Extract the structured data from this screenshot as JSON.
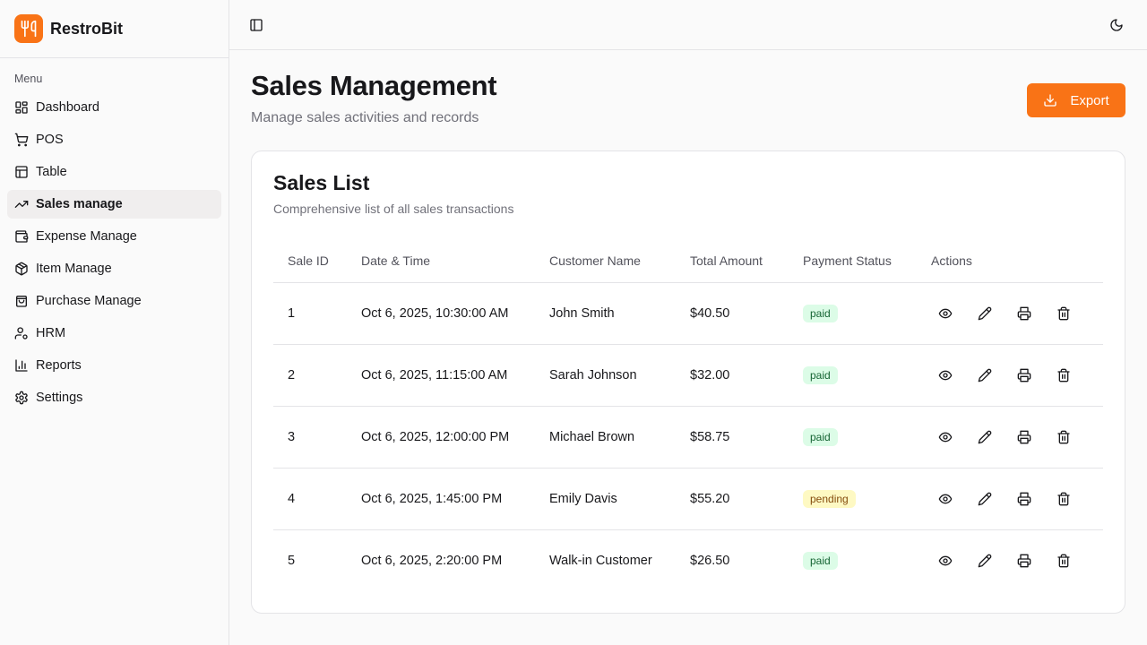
{
  "app": {
    "name": "RestroBit"
  },
  "sidebar": {
    "menu_label": "Menu",
    "items": [
      {
        "label": "Dashboard",
        "icon": "dashboard-icon"
      },
      {
        "label": "POS",
        "icon": "cart-icon"
      },
      {
        "label": "Table",
        "icon": "table-icon"
      },
      {
        "label": "Sales manage",
        "icon": "trending-up-icon",
        "active": true
      },
      {
        "label": "Expense Manage",
        "icon": "wallet-icon"
      },
      {
        "label": "Item Manage",
        "icon": "package-icon"
      },
      {
        "label": "Purchase Manage",
        "icon": "shopping-bag-icon"
      },
      {
        "label": "HRM",
        "icon": "user-cog-icon"
      },
      {
        "label": "Reports",
        "icon": "bar-chart-icon"
      },
      {
        "label": "Settings",
        "icon": "gear-icon"
      }
    ]
  },
  "header": {
    "title": "Sales Management",
    "subtitle": "Manage sales activities and records",
    "export_label": "Export"
  },
  "card": {
    "title": "Sales List",
    "description": "Comprehensive list of all sales transactions"
  },
  "table": {
    "columns": [
      "Sale ID",
      "Date & Time",
      "Customer Name",
      "Total Amount",
      "Payment Status",
      "Actions"
    ],
    "rows": [
      {
        "id": "1",
        "datetime": "Oct 6, 2025, 10:30:00 AM",
        "customer": "John Smith",
        "amount": "$40.50",
        "status": "paid"
      },
      {
        "id": "2",
        "datetime": "Oct 6, 2025, 11:15:00 AM",
        "customer": "Sarah Johnson",
        "amount": "$32.00",
        "status": "paid"
      },
      {
        "id": "3",
        "datetime": "Oct 6, 2025, 12:00:00 PM",
        "customer": "Michael Brown",
        "amount": "$58.75",
        "status": "paid"
      },
      {
        "id": "4",
        "datetime": "Oct 6, 2025, 1:45:00 PM",
        "customer": "Emily Davis",
        "amount": "$55.20",
        "status": "pending"
      },
      {
        "id": "5",
        "datetime": "Oct 6, 2025, 2:20:00 PM",
        "customer": "Walk-in Customer",
        "amount": "$26.50",
        "status": "paid"
      }
    ]
  },
  "colors": {
    "accent": "#f97316",
    "paid_bg": "#dcfce7",
    "pending_bg": "#fef9c3"
  }
}
